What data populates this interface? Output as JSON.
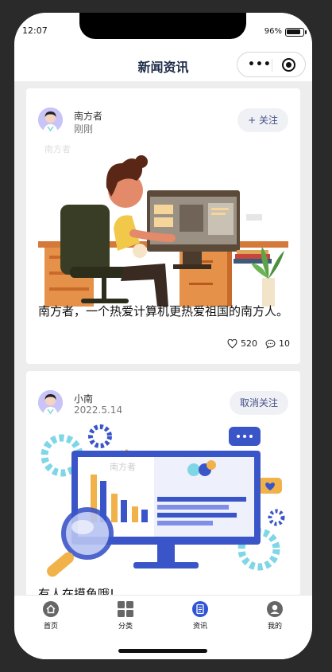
{
  "status": {
    "time": "12:07",
    "battery": "96%"
  },
  "nav": {
    "title": "新闻资讯"
  },
  "posts": [
    {
      "author": "南方者",
      "time": "刚刚",
      "follow_label": "+ 关注",
      "watermark": "南方者",
      "text": "南方者，一个热爱计算机更热爱祖国的南方人。",
      "likes": "520",
      "comments": "10"
    },
    {
      "author": "小南",
      "time": "2022.5.14",
      "follow_label": "取消关注",
      "watermark": "南方者",
      "text": "有人在摸鱼哦!"
    }
  ],
  "tabs": [
    {
      "label": "首页",
      "icon": "home-icon"
    },
    {
      "label": "分类",
      "icon": "grid-icon"
    },
    {
      "label": "资讯",
      "icon": "news-icon",
      "active": true
    },
    {
      "label": "我的",
      "icon": "user-icon"
    }
  ],
  "colors": {
    "active_tab": "#2f54d6",
    "inactive_tab": "#666666",
    "title": "#1f2d4a"
  }
}
